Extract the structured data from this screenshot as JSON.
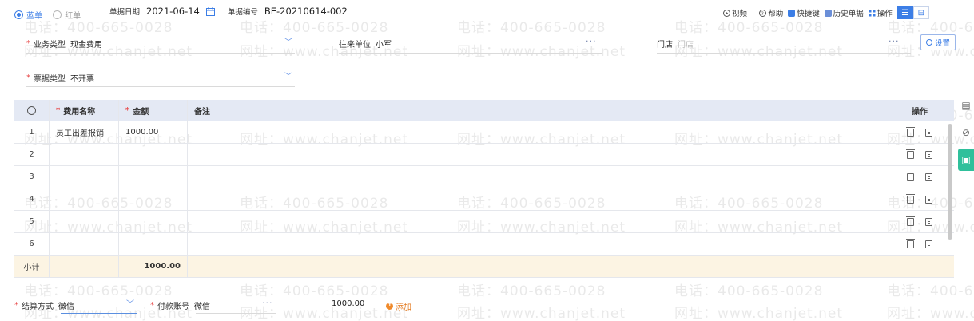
{
  "watermark": {
    "phone": "电话：400-665-0028",
    "site": "网址：www.chanjet.net"
  },
  "top": {
    "radio_blue": "蓝单",
    "radio_red": "红单",
    "date_label": "单据日期",
    "date_value": "2021-06-14",
    "code_label": "单据编号",
    "code_value": "BE-20210614-002"
  },
  "toolbar": {
    "video": "视频",
    "help": "帮助",
    "shortcut": "快捷键",
    "history": "历史单据",
    "ops": "操作",
    "view_list": "☰",
    "view_split": "⊟"
  },
  "form": {
    "biz_type_label": "业务类型",
    "biz_type_value": "现金费用",
    "partner_label": "往来单位",
    "partner_value": "小军",
    "store_label": "门店",
    "store_placeholder": "门店",
    "settings_label": "设置",
    "invoice_label": "票据类型",
    "invoice_value": "不开票"
  },
  "table": {
    "headers": {
      "name": "费用名称",
      "amount": "金额",
      "memo": "备注",
      "ops": "操作"
    },
    "rows": [
      {
        "idx": "1",
        "name": "员工出差报销",
        "amount": "1000.00",
        "memo": ""
      },
      {
        "idx": "2",
        "name": "",
        "amount": "",
        "memo": ""
      },
      {
        "idx": "3",
        "name": "",
        "amount": "",
        "memo": ""
      },
      {
        "idx": "4",
        "name": "",
        "amount": "",
        "memo": ""
      },
      {
        "idx": "5",
        "name": "",
        "amount": "",
        "memo": ""
      },
      {
        "idx": "6",
        "name": "",
        "amount": "",
        "memo": ""
      }
    ],
    "subtotal_label": "小计",
    "subtotal_amount": "1000.00"
  },
  "footer": {
    "settle_label": "结算方式",
    "settle_value": "微信",
    "account_label": "付款账号",
    "account_value": "微信",
    "amount": "1000.00",
    "add_label": "添加"
  },
  "colors": {
    "accent": "#3c7ee6",
    "header_bg": "#e4e9f4",
    "subtotal_bg": "#fcf4e3",
    "required": "#e84646",
    "side_green": "#2fc09b"
  }
}
